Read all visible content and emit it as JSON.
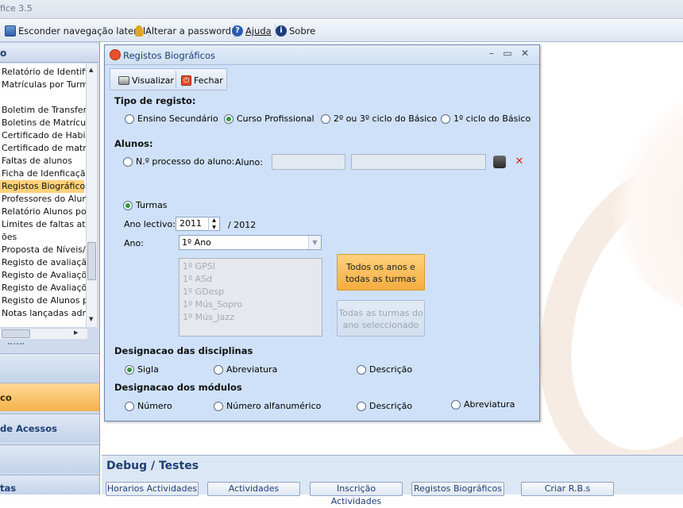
{
  "app": {
    "title_fragment": "fice 3.5"
  },
  "toolbar": {
    "toggle_nav": "Esconder navegação lateral",
    "change_password": "Alterar a password",
    "help": "Ajuda",
    "about": "Sobre"
  },
  "sidebar": {
    "items": [
      "Relatório de Identifi",
      "Matrículas por Turm",
      "",
      "Boletim de Transferê",
      "Boletins de Matrícula",
      "Certificado de Habili",
      "Certificado de matrí",
      "Faltas de alunos",
      "Ficha de Idenficação",
      "Registos Biográficos",
      "Professores do Aluno",
      "Relatório Alunos po",
      "Limites de faltas atin",
      "ões",
      "Proposta de Níveis/C",
      "Registo de avaliaçã",
      "Registo de Avaliaçõe",
      "Registo de Avaliaçõ",
      "Registo de Alunos p",
      "Notas lançadas adm"
    ],
    "selected_index": 9,
    "buttons": [
      "",
      "co",
      "de Acessos",
      "",
      "tas"
    ]
  },
  "dialog": {
    "title": "Registos Biográficos",
    "toolbar": {
      "view": "Visualizar",
      "close": "Fechar"
    },
    "tipo_registo": {
      "label": "Tipo de registo:",
      "options": [
        "Ensino Secundário",
        "Curso Profissional",
        "2º ou 3º ciclo do Básico",
        "1º ciclo do Básico"
      ],
      "selected": "Curso Profissional"
    },
    "alunos": {
      "label": "Alunos:",
      "processo_label": "N.º processo do aluno:",
      "aluno_label": "Aluno:",
      "turmas_label": "Turmas",
      "ano_lectivo_label": "Ano lectivo:",
      "ano_lectivo_value": "2011",
      "ano_lectivo_end": "/ 2012",
      "ano_label": "Ano:",
      "ano_value": "1º Ano",
      "turmas": [
        "1º GPSI",
        "1º ASd",
        "1º GDesp",
        "1º Mús_Sopro",
        "1º Mús_Jazz"
      ],
      "btn_todos": "Todos os anos e todas as turmas",
      "btn_ano": "Todas as turmas do ano seleccionado"
    },
    "disciplinas": {
      "label": "Designacao das disciplinas",
      "options": [
        "Sigla",
        "Abreviatura",
        "Descrição"
      ],
      "selected": "Sigla"
    },
    "modulos": {
      "label": "Designacao dos módulos",
      "options": [
        "Número",
        "Número alfanumérico",
        "Descrição",
        "Abreviatura"
      ]
    }
  },
  "debug": {
    "title": "Debug / Testes",
    "buttons": [
      "Horarios Actividades",
      "Actividades",
      "Inscrição Actividades",
      "Registos Biográficos",
      "Criar R.B.s"
    ]
  }
}
